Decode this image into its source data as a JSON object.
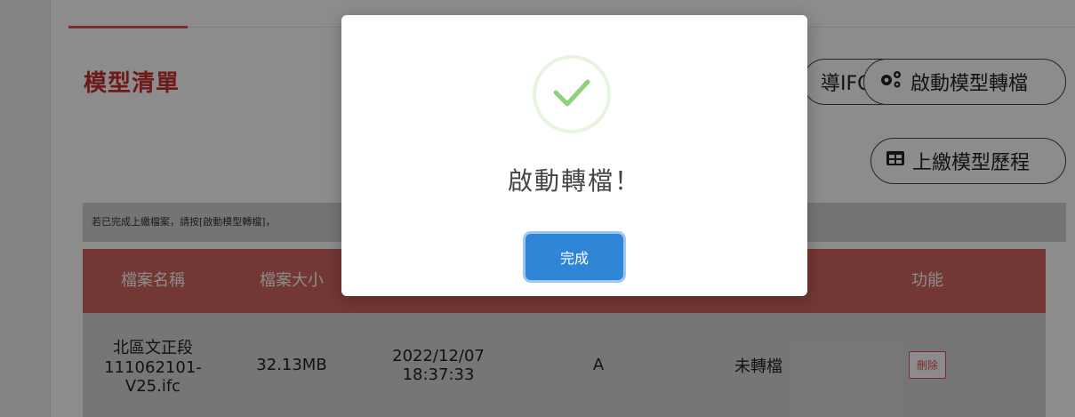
{
  "page": {
    "title": "模型清單",
    "export_ifc_label": "導IFC",
    "convert_label": "啟動模型轉檔",
    "history_label": "上繳模型歷程",
    "notice": "若已完成上繳檔案，請按[啟動模型轉檔]，",
    "table": {
      "headers": [
        "檔案名稱",
        "檔案大小",
        "",
        "",
        "",
        "功能"
      ],
      "rows": [
        {
          "file_name": "北區文正段\n111062101-\nV25.ifc",
          "file_size": "32.13MB",
          "datetime": "2022/12/07\n18:37:33",
          "version": "A",
          "status": "未轉檔",
          "action": "刪除"
        }
      ]
    }
  },
  "modal": {
    "title": "啟動轉檔！",
    "confirm_label": "完成"
  },
  "icons": {
    "success": "check-icon",
    "convert": "gears-icon",
    "history": "table-icon"
  },
  "colors": {
    "accent_red": "#c9302c",
    "header_bg": "#d2655f",
    "confirm_blue": "#2f86d6",
    "success_green": "#8fd17a"
  }
}
